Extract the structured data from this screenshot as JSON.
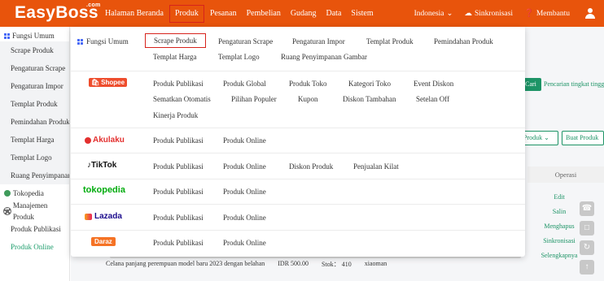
{
  "brand": {
    "name": "EasyBoss",
    "suffix": ".com"
  },
  "nav": {
    "items": [
      "Halaman Beranda",
      "Produk",
      "Pesanan",
      "Pembelian",
      "Gudang",
      "Data",
      "Sistem"
    ],
    "active": "Produk",
    "language": "Indonesia",
    "sync": "Sinkronisasi",
    "help": "Membantu"
  },
  "sidebar": {
    "group1": "Fungsi Umum",
    "group1_items": [
      "Scrape Produk",
      "Pengaturan Scrape",
      "Pengaturan Impor",
      "Templat Produk",
      "Pemindahan Produk",
      "Templat Harga",
      "Templat Logo",
      "Ruang Penyimpanan"
    ],
    "group2": "Tokopedia",
    "group3": "Manajemen Produk",
    "group3_items": [
      "Produk Publikasi",
      "Produk Online"
    ],
    "selected": "Produk Online"
  },
  "background": {
    "search_button": "Cari",
    "advanced_search": "Pencarian tingkat tinggi",
    "select1": "n Produk",
    "button2": "Buat Produk",
    "operations_header": "Operasi",
    "actions": [
      "Edit",
      "Salin",
      "Menghapus",
      "Sinkronisasi",
      "Selengkapnya"
    ],
    "row_title": "Celana panjang perempuan model baru 2023 dengan belahan",
    "row_price": "IDR 500.00",
    "row_stock": "Stok： 410",
    "row_store": "xiaoman",
    "row_edit": "Edit"
  },
  "dropdown": {
    "fungsi_umum": {
      "label": "Fungsi Umum",
      "row1": [
        "Scrape Produk",
        "Pengaturan Scrape",
        "Pengaturan Impor",
        "Templat Produk",
        "Pemindahan Produk"
      ],
      "row2": [
        "Templat Harga",
        "Templat Logo",
        "Ruang Penyimpanan Gambar"
      ]
    },
    "shopee": {
      "logo": "Shopee",
      "row1": [
        "Produk Publikasi",
        "Produk Global",
        "Produk Toko",
        "Kategori Toko",
        "Event Diskon"
      ],
      "row2": [
        "Sematkan Otomatis",
        "Pilihan Populer",
        "Kupon",
        "Diskon Tambahan",
        "Setelan Off"
      ],
      "row3": [
        "Kinerja Produk"
      ]
    },
    "akulaku": {
      "logo": "Akulaku",
      "items": [
        "Produk Publikasi",
        "Produk Online"
      ]
    },
    "tiktok": {
      "logo": "TikTok",
      "items": [
        "Produk Publikasi",
        "Produk Online",
        "Diskon Produk",
        "Penjualan Kilat"
      ]
    },
    "tokopedia": {
      "logo": "tokopedia",
      "items": [
        "Produk Publikasi",
        "Produk Online"
      ]
    },
    "lazada": {
      "logo": "Lazada",
      "items": [
        "Produk Publikasi",
        "Produk Online"
      ]
    },
    "daraz": {
      "logo": "Daraz",
      "items": [
        "Produk Publikasi",
        "Produk Online"
      ]
    }
  }
}
